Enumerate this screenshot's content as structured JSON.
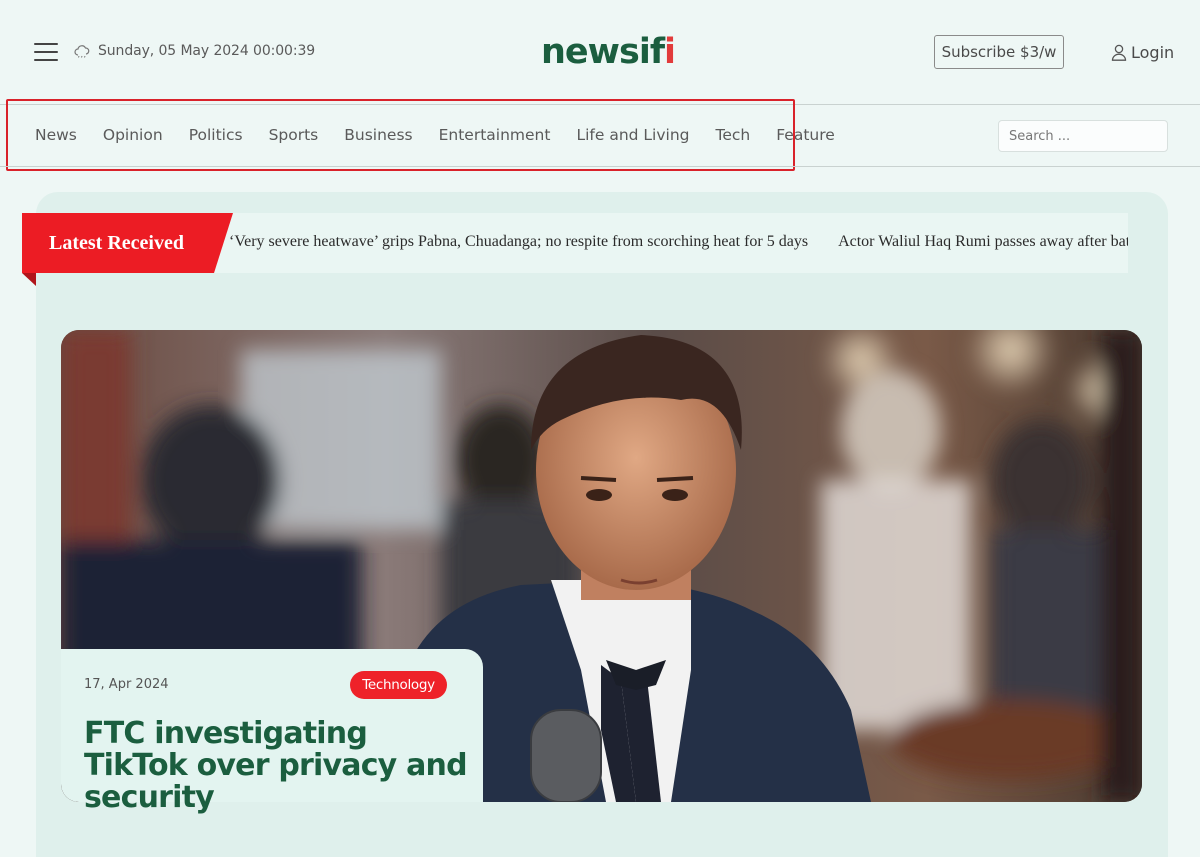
{
  "header": {
    "datetime": "Sunday, 05 May 2024 00:00:39",
    "logo_main": "newsif",
    "logo_accent": "i",
    "subscribe_label": "Subscribe $3/w",
    "login_label": "Login",
    "icons": {
      "menu": "hamburger-menu-icon",
      "weather": "cloud-icon",
      "login": "user-icon"
    }
  },
  "nav": {
    "items": [
      "News",
      "Opinion",
      "Politics",
      "Sports",
      "Business",
      "Entertainment",
      "Life and Living",
      "Tech",
      "Feature"
    ]
  },
  "search": {
    "placeholder": "Search ..."
  },
  "ticker": {
    "label": "Latest Received",
    "headlines": [
      "‘Very severe heatwave’ grips Pabna, Chuadanga; no respite from scorching heat for 5 days",
      "Actor Waliul Haq Rumi passes away after battl"
    ]
  },
  "featured": {
    "date": "17, Apr 2024",
    "category": "Technology",
    "title": "FTC investigating TikTok over privacy and security"
  },
  "colors": {
    "page_bg": "#eef7f5",
    "brand_green": "#1b5e3f",
    "accent_red": "#ec1c24",
    "highlight_red": "#d9222a"
  }
}
